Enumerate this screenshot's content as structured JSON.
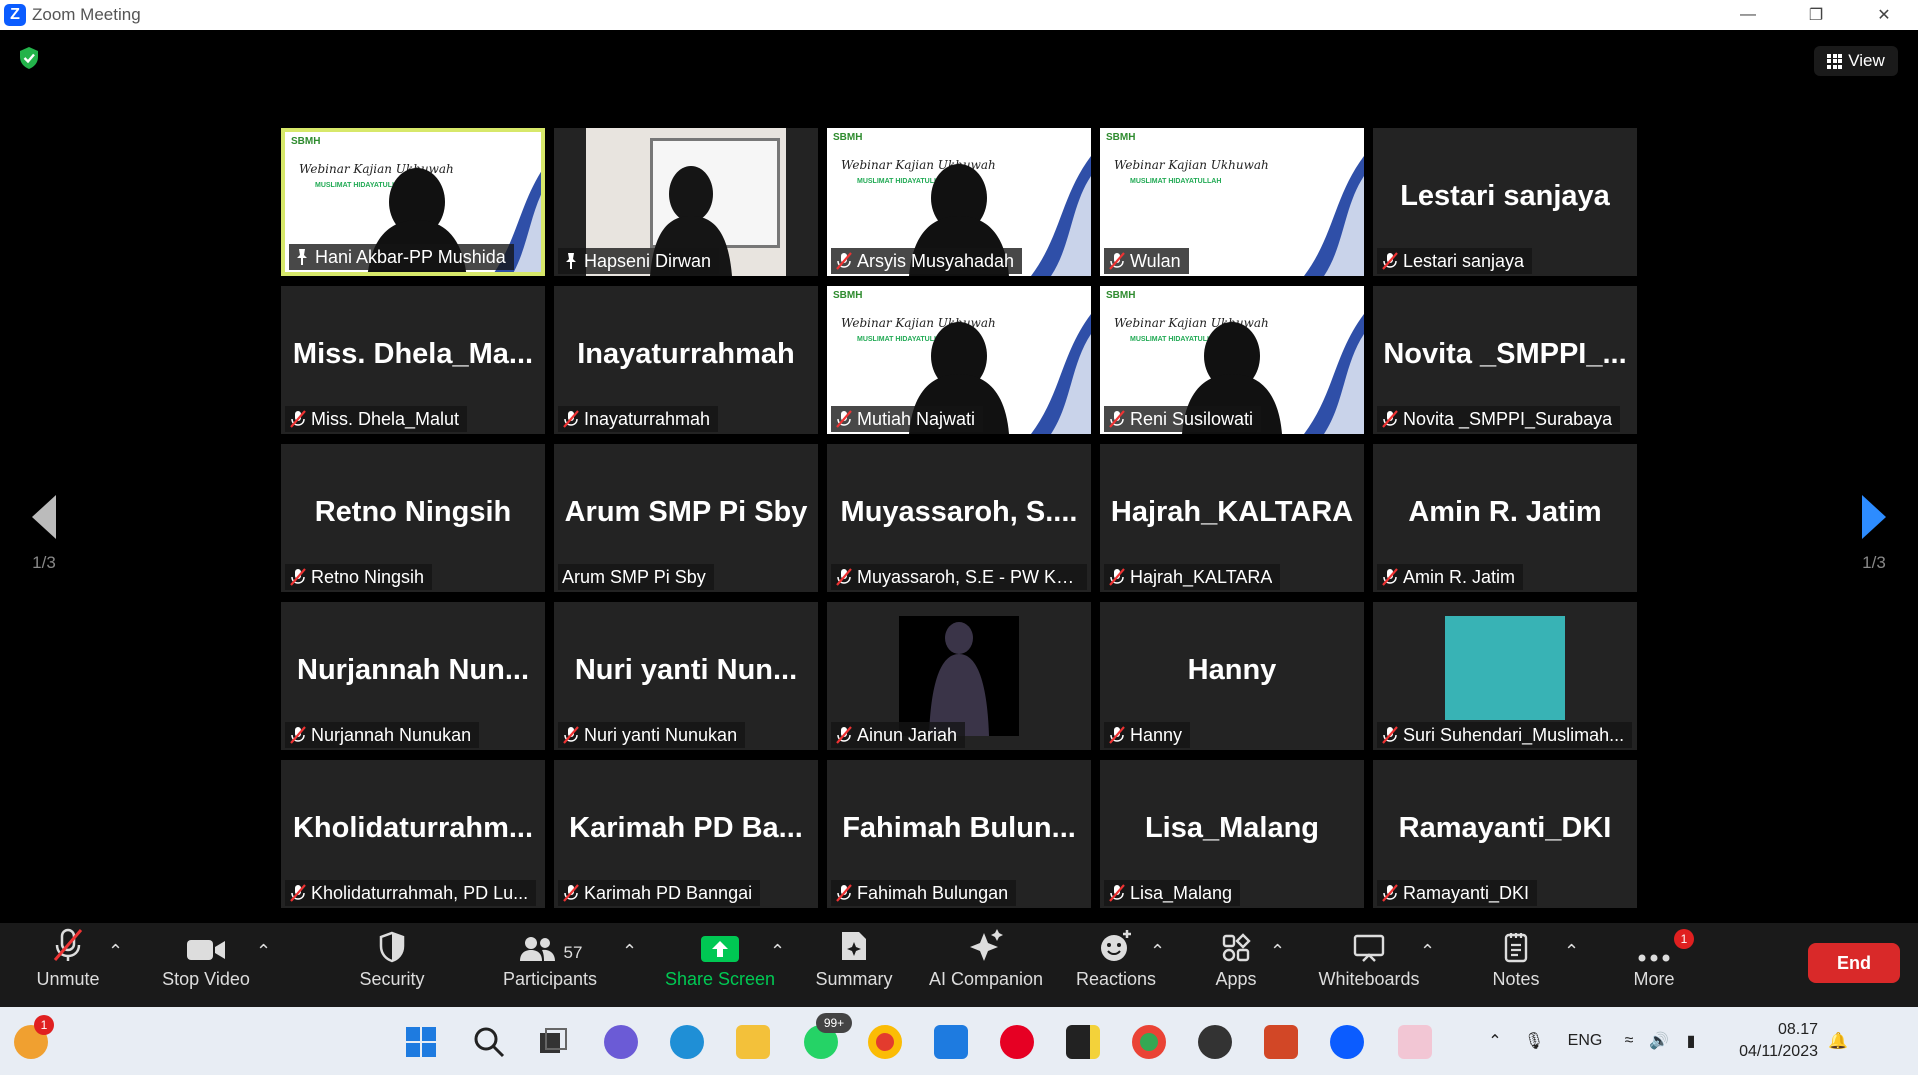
{
  "window": {
    "title": "Zoom Meeting",
    "view_label": "View"
  },
  "nav": {
    "left_page": "1/3",
    "right_page": "1/3"
  },
  "tiles": [
    {
      "big": "",
      "label": "Hani Akbar-PP Mushida",
      "muted": false,
      "pin": true,
      "active": true
    },
    {
      "big": "",
      "label": "Hapseni Dirwan",
      "muted": false,
      "pin": true
    },
    {
      "big": "",
      "label": "Arsyis Musyahadah",
      "muted": true
    },
    {
      "big": "",
      "label": "Wulan",
      "muted": true
    },
    {
      "big": "Lestari sanjaya",
      "label": "Lestari sanjaya",
      "muted": true
    },
    {
      "big": "Miss.  Dhela_Ma...",
      "label": "Miss. Dhela_Malut",
      "muted": true
    },
    {
      "big": "Inayaturrahmah",
      "label": "Inayaturrahmah",
      "muted": true
    },
    {
      "big": "",
      "label": "Mutiah Najwati",
      "muted": true
    },
    {
      "big": "",
      "label": "Reni Susilowati",
      "muted": true
    },
    {
      "big": "Novita  _SMPPI_...",
      "label": "Novita _SMPPI_Surabaya",
      "muted": true
    },
    {
      "big": "Retno Ningsih",
      "label": "Retno Ningsih",
      "muted": true
    },
    {
      "big": "Arum SMP Pi Sby",
      "label": "Arum SMP Pi Sby",
      "muted": false
    },
    {
      "big": "Muyassaroh,  S....",
      "label": "Muyassaroh, S.E - PW Ke...",
      "muted": true
    },
    {
      "big": "Hajrah_KALTARA",
      "label": "Hajrah_KALTARA",
      "muted": true
    },
    {
      "big": "Amin R. Jatim",
      "label": "Amin R. Jatim",
      "muted": true
    },
    {
      "big": "Nurjannah  Nun...",
      "label": "Nurjannah Nunukan",
      "muted": true
    },
    {
      "big": "Nuri  yanti  Nun...",
      "label": "Nuri yanti Nunukan",
      "muted": true
    },
    {
      "big": "",
      "label": "Ainun Jariah",
      "muted": true
    },
    {
      "big": "Hanny",
      "label": "Hanny",
      "muted": true
    },
    {
      "big": "",
      "label": "Suri Suhendari_Muslimah...",
      "muted": true
    },
    {
      "big": "Kholidaturrahm...",
      "label": "Kholidaturrahmah, PD Lu...",
      "muted": true
    },
    {
      "big": "Karimah  PD  Ba...",
      "label": "Karimah PD Banngai",
      "muted": true
    },
    {
      "big": "Fahimah  Bulun...",
      "label": "Fahimah Bulungan",
      "muted": true
    },
    {
      "big": "Lisa_Malang",
      "label": "Lisa_Malang",
      "muted": true
    },
    {
      "big": "Ramayanti_DKI",
      "label": "Ramayanti_DKI",
      "muted": true
    }
  ],
  "slide": {
    "logo": "SBMH",
    "title": "Webinar Kajian Ukhuwah",
    "subtitle": "MUSLIMAT HIDAYATULLAH"
  },
  "toolbar": {
    "unmute": "Unmute",
    "stop_video": "Stop Video",
    "security": "Security",
    "participants": "Participants",
    "participants_count": "57",
    "share_screen": "Share Screen",
    "summary": "Summary",
    "ai_companion": "AI Companion",
    "reactions": "Reactions",
    "apps": "Apps",
    "whiteboards": "Whiteboards",
    "notes": "Notes",
    "more": "More",
    "more_badge": "1",
    "end": "End"
  },
  "taskbar": {
    "weather_badge": "1",
    "whatsapp_badge": "99+",
    "lang": "ENG",
    "time": "08.17",
    "date": "04/11/2023"
  },
  "colors": {
    "accent": "#2d8cff",
    "active_border": "#d7e86a",
    "end_red": "#d92929",
    "share_green": "#00c853"
  }
}
